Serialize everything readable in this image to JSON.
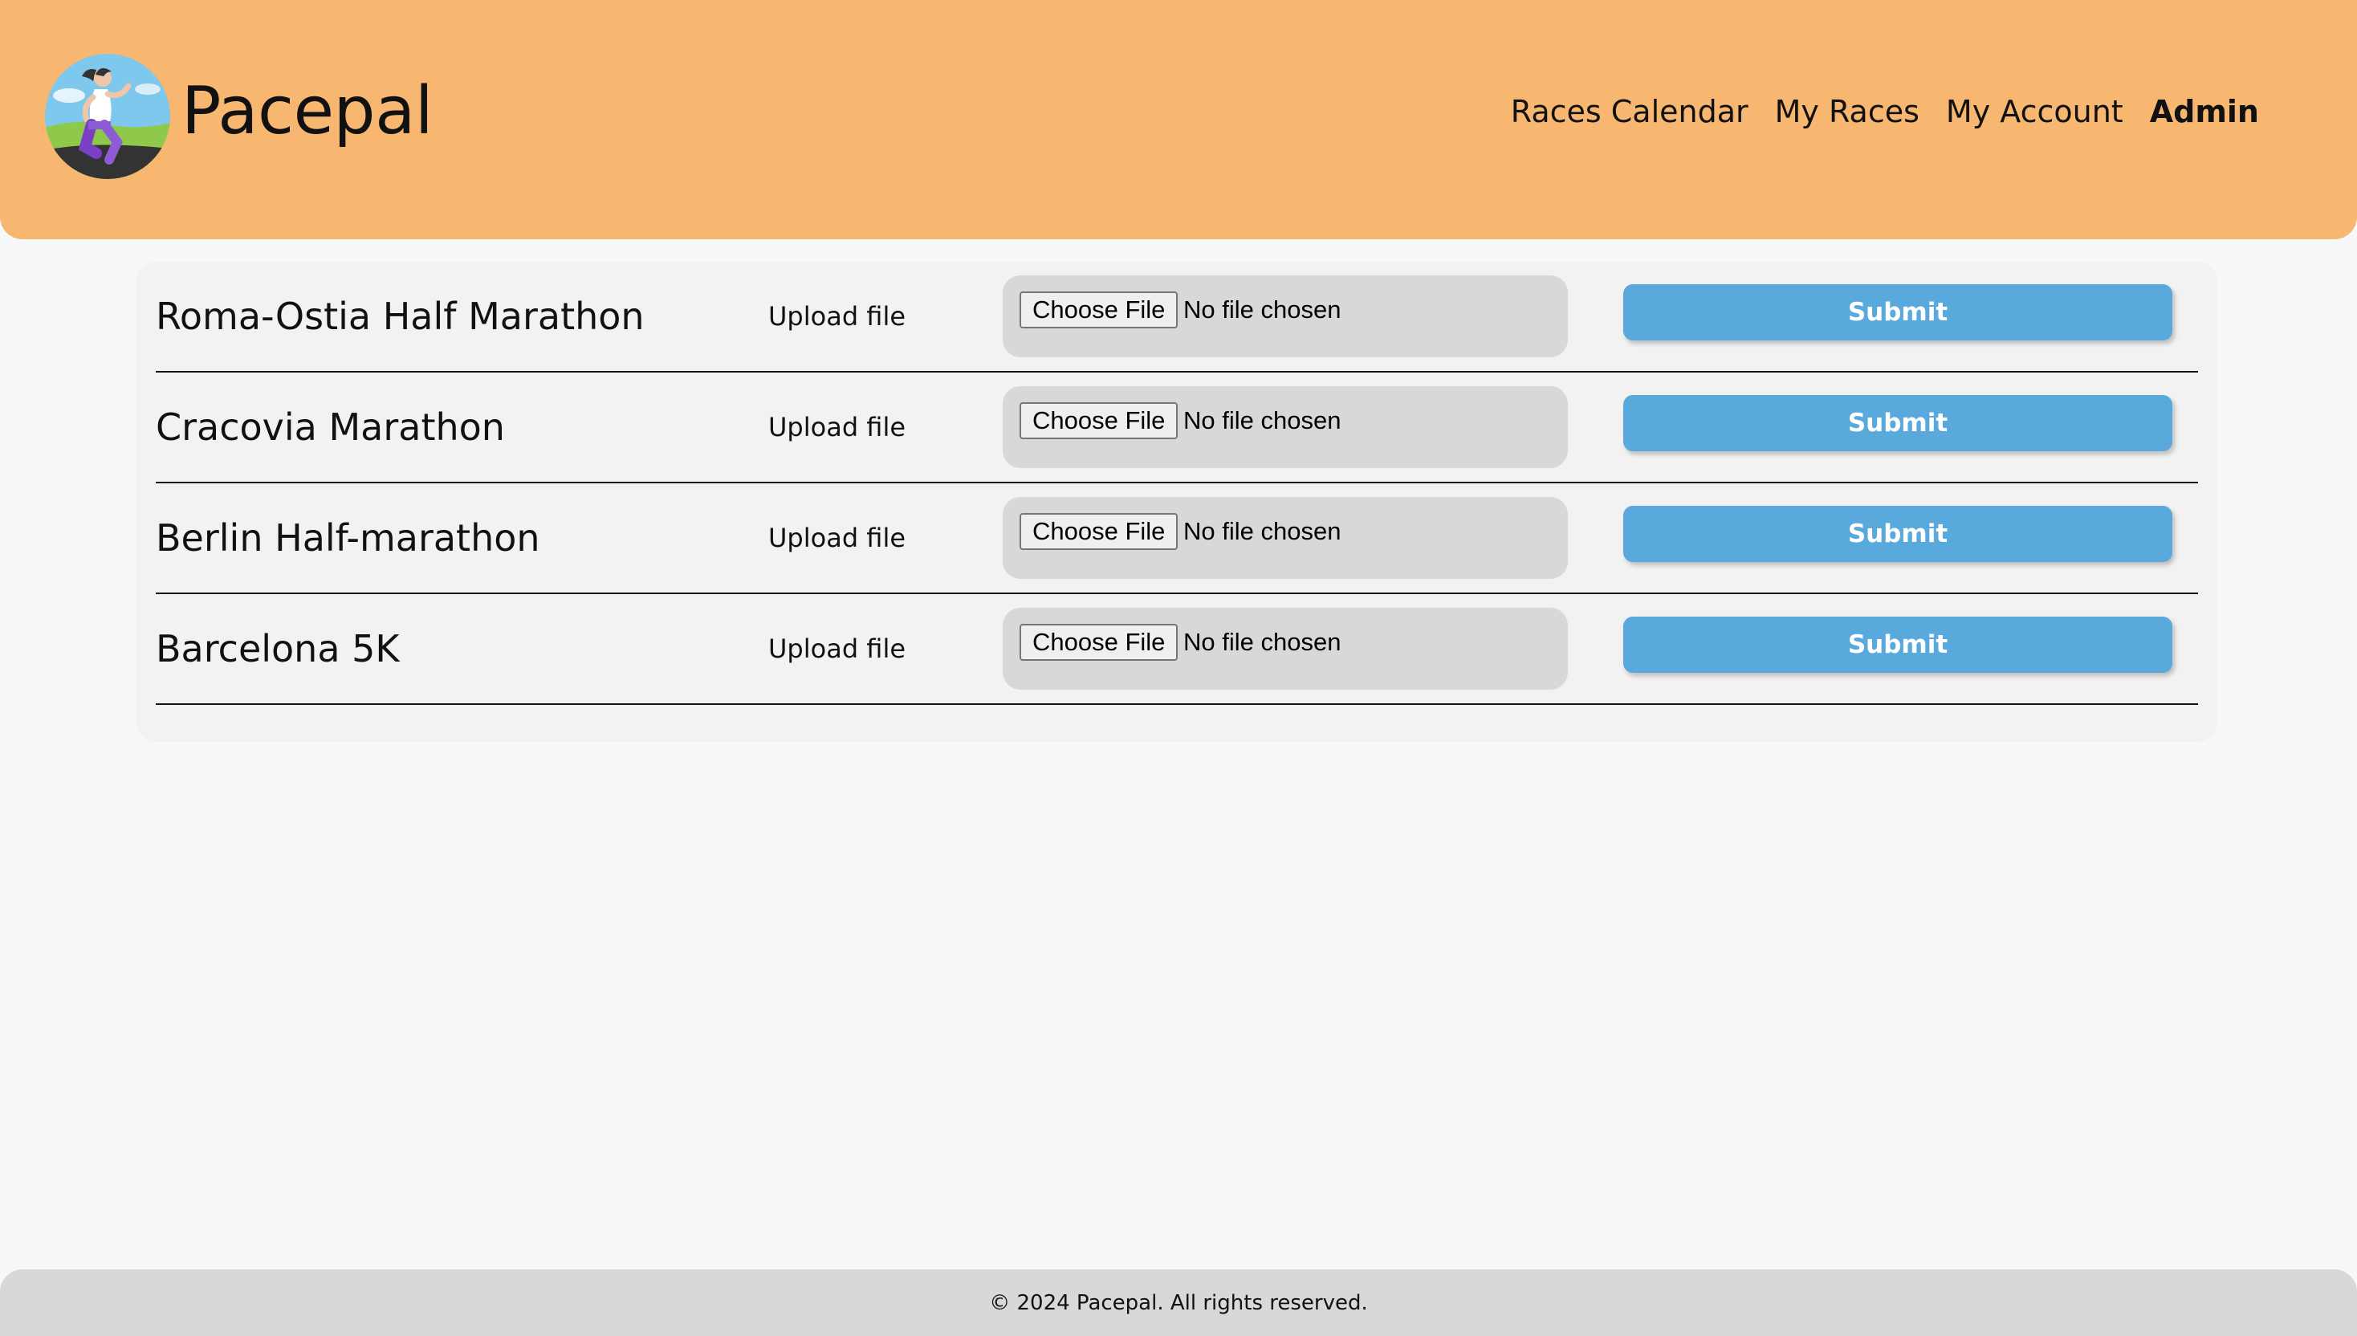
{
  "header": {
    "brand": "Pacepal",
    "logo_icon": "runner-logo-icon",
    "nav": {
      "races_calendar": "Races Calendar",
      "my_races": "My Races",
      "my_account": "My Account",
      "admin": "Admin"
    }
  },
  "races": [
    {
      "name": "Roma-Ostia Half Marathon",
      "upload_label": "Upload file",
      "choose_file": "Choose File",
      "file_status": "No file chosen",
      "submit": "Submit"
    },
    {
      "name": "Cracovia Marathon",
      "upload_label": "Upload file",
      "choose_file": "Choose File",
      "file_status": "No file chosen",
      "submit": "Submit"
    },
    {
      "name": "Berlin Half-marathon",
      "upload_label": "Upload file",
      "choose_file": "Choose File",
      "file_status": "No file chosen",
      "submit": "Submit"
    },
    {
      "name": "Barcelona 5K",
      "upload_label": "Upload file",
      "choose_file": "Choose File",
      "file_status": "No file chosen",
      "submit": "Submit"
    }
  ],
  "footer": {
    "copyright": "© 2024 Pacepal. All rights reserved."
  },
  "colors": {
    "header_bg": "#f8b770",
    "submit_bg": "#5aa9dc",
    "footer_bg": "#d8d8d8",
    "page_bg": "#f7f8fa"
  }
}
